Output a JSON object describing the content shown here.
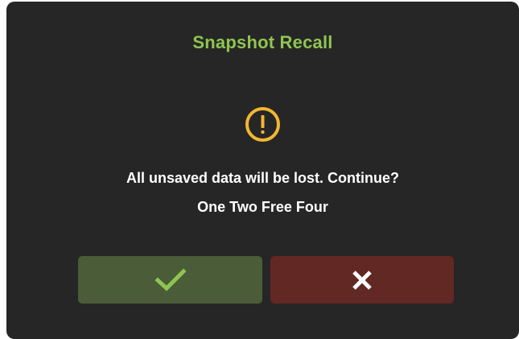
{
  "dialog": {
    "title": "Snapshot Recall",
    "icon": "warning-icon",
    "message": "All unsaved data will be lost. Continue?",
    "subtext": "One Two Free Four"
  },
  "buttons": {
    "confirm": {
      "icon": "checkmark-icon"
    },
    "cancel": {
      "icon": "close-icon"
    }
  },
  "colors": {
    "background": "#262626",
    "title": "#8fc551",
    "warning": "#f2b632",
    "text": "#ffffff",
    "confirm_bg": "#4a5c38",
    "confirm_icon": "#8fc551",
    "cancel_bg": "#622823",
    "cancel_icon": "#ffffff"
  }
}
